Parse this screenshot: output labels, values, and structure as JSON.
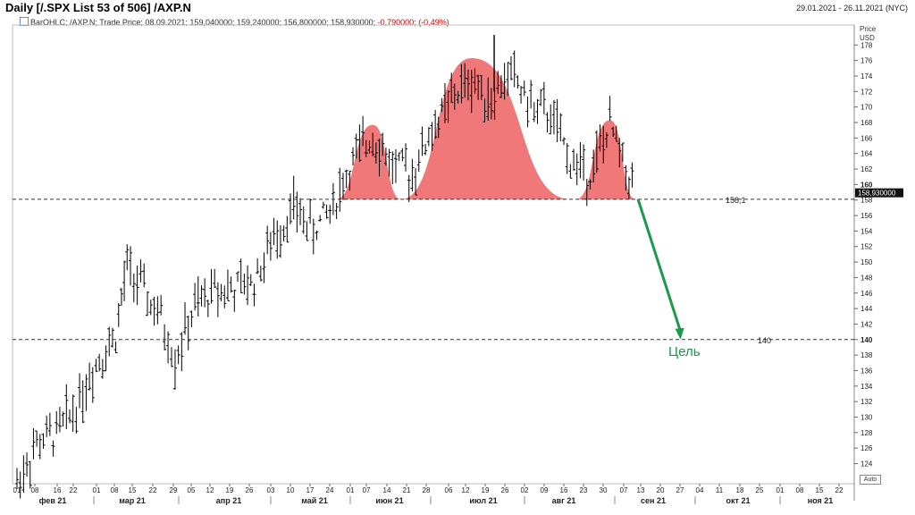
{
  "header": {
    "title": "Daily [/.SPX List 53 of 506] /AXP.N",
    "date_range": "29.01.2021 - 26.11.2021 (NYC)",
    "legend": {
      "prefix": "BarOHLC; /AXP.N; Trade Price; 08.09.2021; 159,040000; 159,240000; 156,800000; 158,930000;",
      "change": "-0,790000; (-0,49%)"
    }
  },
  "axis": {
    "price_header_1": "Price",
    "price_header_2": "USD",
    "auto_label": "Auto",
    "last_price_label": "158,930000",
    "y_ticks": [
      124,
      126,
      128,
      130,
      132,
      134,
      136,
      138,
      140,
      142,
      144,
      146,
      148,
      150,
      152,
      154,
      156,
      158,
      160,
      162,
      164,
      166,
      168,
      170,
      172,
      174,
      176,
      178
    ],
    "x_day_ticks": [
      "01",
      "08",
      "16",
      "22",
      "01",
      "08",
      "15",
      "22",
      "29",
      "05",
      "12",
      "19",
      "26",
      "03",
      "10",
      "17",
      "24",
      "01",
      "07",
      "14",
      "21",
      "28",
      "06",
      "12",
      "19",
      "26",
      "02",
      "09",
      "16",
      "23",
      "30",
      "07",
      "13",
      "20",
      "27",
      "04",
      "11",
      "18",
      "25",
      "01",
      "08",
      "15",
      "22"
    ],
    "x_month_labels": [
      "фев 21",
      "мар 21",
      "апр 21",
      "май 21",
      "июн 21",
      "июл 21",
      "авг 21",
      "сен 21",
      "окт 21",
      "ноя 21"
    ]
  },
  "annotations": {
    "neckline_label": "158,1",
    "target_line_label": "140",
    "target_text": "Цель"
  },
  "colors": {
    "pattern_fill": "#f07878",
    "arrow": "#1a9a4a",
    "bars": "#000000"
  },
  "chart_data": {
    "type": "ohlc_bar",
    "ylabel": "Price USD",
    "ylim": [
      122.5,
      179.5
    ],
    "x_range": [
      "2021-01-29",
      "2021-11-26"
    ],
    "neckline": 158.1,
    "target": 140,
    "last_close": 158.93,
    "pattern": "head-and-shoulders",
    "shoulders_and_head": [
      {
        "part": "left-shoulder",
        "start": "2021-05-25",
        "peak_date": "2021-06-07",
        "peak": 167.7,
        "end": "2021-06-17"
      },
      {
        "part": "head",
        "start": "2021-06-17",
        "peak_date": "2021-07-12",
        "peak": 176.3,
        "end": "2021-08-16"
      },
      {
        "part": "right-shoulder",
        "start": "2021-08-18",
        "peak_date": "2021-08-30",
        "peak": 168.3,
        "end": "2021-09-08"
      }
    ],
    "projection": {
      "from_date": "2021-09-08",
      "from": 158.1,
      "to_date": "2021-09-24",
      "to": 140
    },
    "closes": [
      [
        "2021-02-01",
        121.5
      ],
      [
        "2021-02-08",
        126.5
      ],
      [
        "2021-02-15",
        128.0
      ],
      [
        "2021-02-22",
        131.5
      ],
      [
        "2021-03-01",
        137.0
      ],
      [
        "2021-03-08",
        140.5
      ],
      [
        "2021-03-12",
        149.5
      ],
      [
        "2021-03-18",
        146.0
      ],
      [
        "2021-03-24",
        142.5
      ],
      [
        "2021-03-29",
        137.5
      ],
      [
        "2021-04-05",
        144.0
      ],
      [
        "2021-04-12",
        146.5
      ],
      [
        "2021-04-19",
        146.5
      ],
      [
        "2021-04-26",
        147.5
      ],
      [
        "2021-05-03",
        153.0
      ],
      [
        "2021-05-10",
        157.0
      ],
      [
        "2021-05-17",
        154.0
      ],
      [
        "2021-05-24",
        157.5
      ],
      [
        "2021-05-31",
        163.0
      ],
      [
        "2021-06-07",
        166.5
      ],
      [
        "2021-06-14",
        162.5
      ],
      [
        "2021-06-21",
        161.5
      ],
      [
        "2021-06-28",
        167.0
      ],
      [
        "2021-07-06",
        171.5
      ],
      [
        "2021-07-12",
        173.5
      ],
      [
        "2021-07-19",
        171.0
      ],
      [
        "2021-07-26",
        174.5
      ],
      [
        "2021-08-02",
        170.0
      ],
      [
        "2021-08-09",
        169.0
      ],
      [
        "2021-08-16",
        163.0
      ],
      [
        "2021-08-23",
        161.5
      ],
      [
        "2021-08-30",
        167.5
      ],
      [
        "2021-09-08",
        158.93
      ]
    ]
  }
}
